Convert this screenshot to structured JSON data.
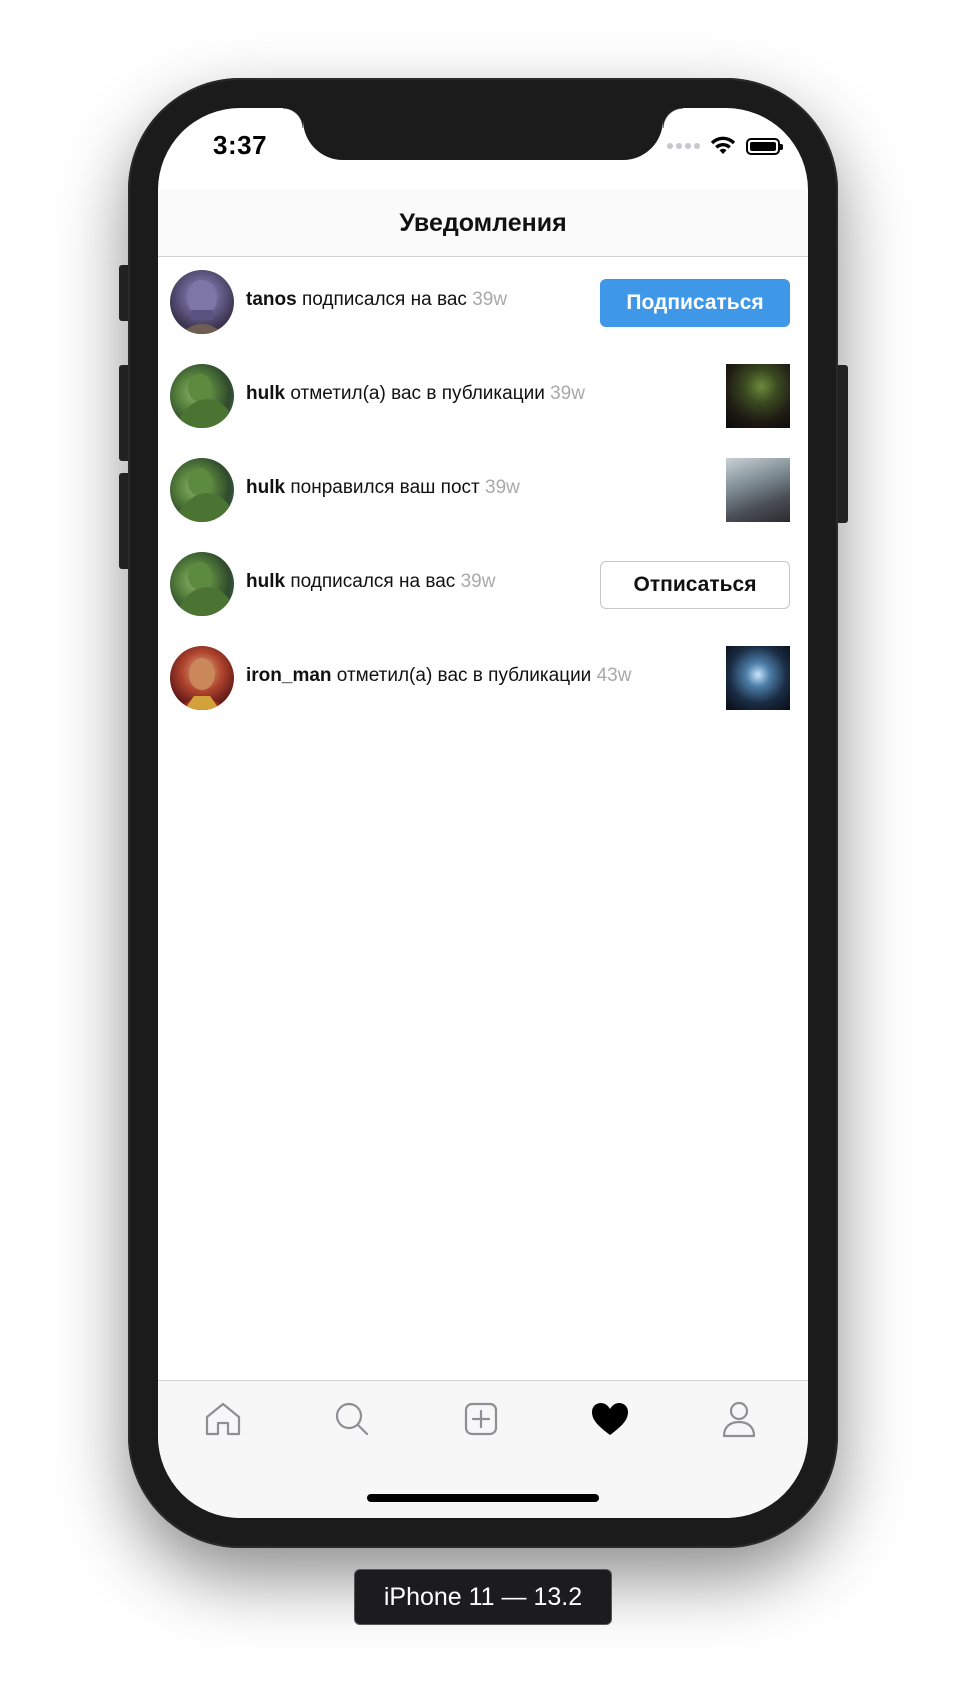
{
  "status_bar": {
    "time": "3:37"
  },
  "navigation": {
    "title": "Уведомления"
  },
  "notifications": [
    {
      "username": "tanos",
      "action": " подписался на вас ",
      "time": " 39w",
      "avatar": "thanos-avatar",
      "accessory": "button",
      "button_label": "Подписаться"
    },
    {
      "username": "hulk",
      "action": " отметил(а) вас в публикации",
      "time": " 39w",
      "avatar": "hulk-avatar",
      "accessory": "thumbnail"
    },
    {
      "username": "hulk",
      "action": " понравился ваш пост ",
      "time": " 39w",
      "avatar": "hulk-avatar",
      "accessory": "thumbnail"
    },
    {
      "username": "hulk",
      "action": " подписался на вас ",
      "time": " 39w",
      "avatar": "hulk-avatar",
      "accessory": "button",
      "button_label": "Отписаться"
    },
    {
      "username": "iron_man",
      "action": " отметил(а) вас в публикации",
      "time": " 43w",
      "avatar": "iron-man-avatar",
      "accessory": "thumbnail"
    }
  ],
  "tab_bar": {
    "items": [
      {
        "icon": "home-icon",
        "active": false
      },
      {
        "icon": "search-icon",
        "active": false
      },
      {
        "icon": "add-icon",
        "active": false
      },
      {
        "icon": "heart-icon",
        "active": true
      },
      {
        "icon": "profile-icon",
        "active": false
      }
    ]
  },
  "colors": {
    "accent_blue": "#3f97e8",
    "timestamp_gray": "#a9a9a9"
  },
  "simulator": {
    "device_label": "iPhone 11 — 13.2"
  }
}
